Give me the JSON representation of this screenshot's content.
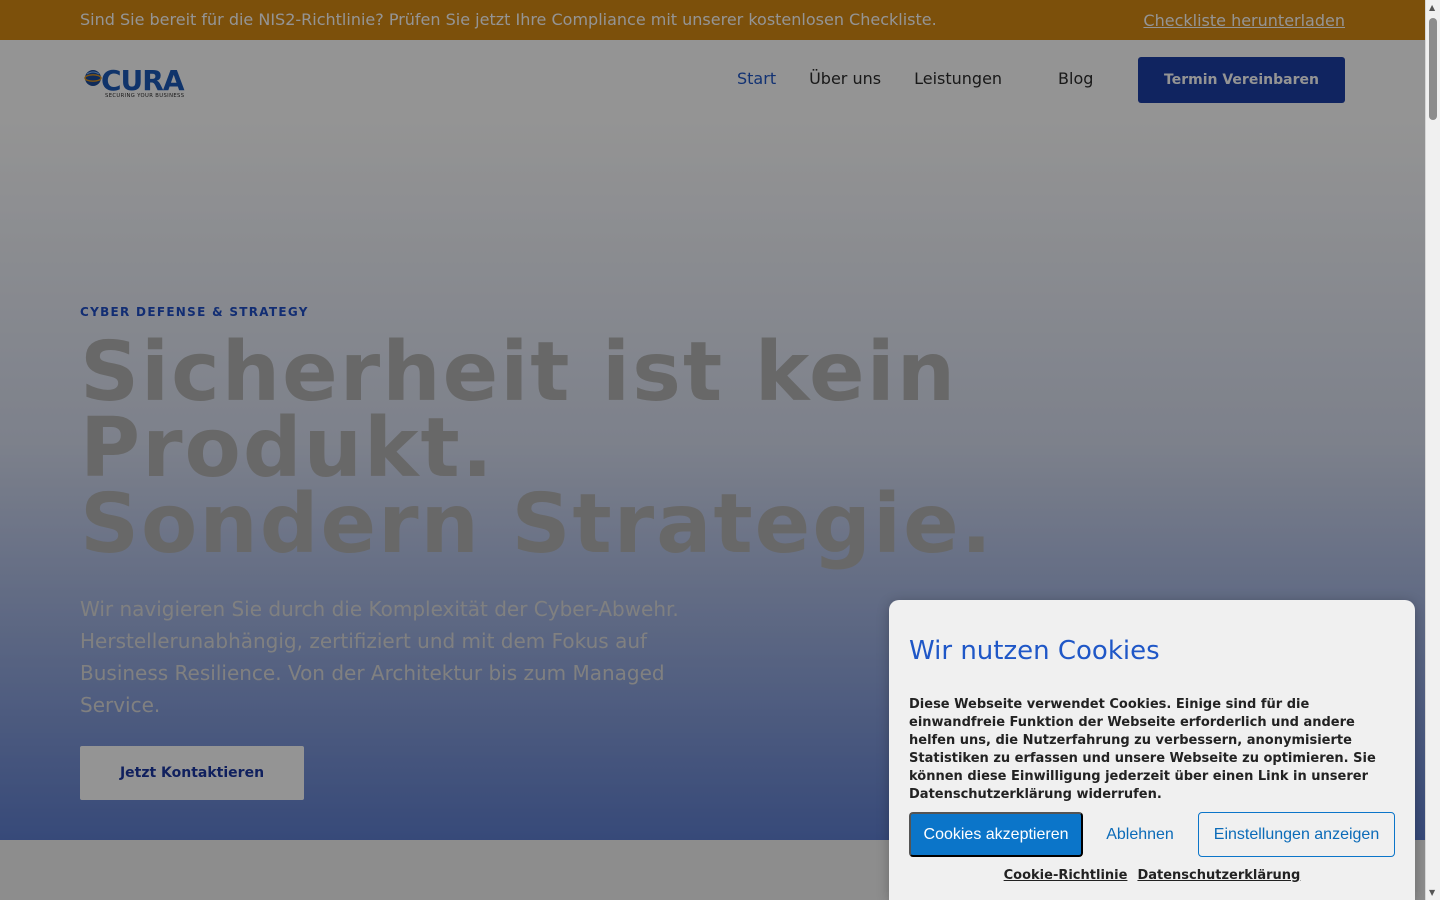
{
  "topbar": {
    "text": "Sind Sie bereit für die NIS2-Richtlinie? Prüfen Sie jetzt Ihre Compliance mit unserer kostenlosen Checkliste.",
    "link": "Checkliste herunterladen"
  },
  "header": {
    "logo": {
      "name": "CURA",
      "tagline": "SECURING YOUR BUSINESS"
    },
    "nav": [
      {
        "label": "Start",
        "active": true
      },
      {
        "label": "Über uns",
        "active": false
      },
      {
        "label": "Leistungen",
        "active": false
      },
      {
        "label": "Blog",
        "active": false
      }
    ],
    "cta": "Termin Vereinbaren"
  },
  "hero": {
    "eyebrow": "CYBER DEFENSE & STRATEGY",
    "headline": [
      "Sicherheit ist kein",
      "Produkt.",
      "Sondern Strategie."
    ],
    "description": "Wir navigieren Sie durch die Komplexität der Cyber-Abwehr. Herstellerunabhängig, zertifiziert und mit dem Fokus auf Business Resilience. Von der Architektur bis zum Managed Service.",
    "cta": "Jetzt Kontaktieren"
  },
  "cookie": {
    "title": "Wir nutzen Cookies",
    "text": "Diese Webseite verwendet Cookies. Einige sind für die einwandfreie Funktion der Webseite erforderlich und andere helfen uns, die Nutzerfahrung zu verbessern, anonymisierte Statistiken zu erfassen und unsere Webseite zu optimieren. Sie können diese Einwilligung jederzeit über einen Link in unserer Datenschutzerklärung widerrufen.",
    "accept": "Cookies akzeptieren",
    "deny": "Ablehnen",
    "settings": "Einstellungen anzeigen",
    "links": [
      "Cookie-Richtlinie",
      "Datenschutzerklärung"
    ]
  },
  "colors": {
    "topbar": "#d68a14",
    "brand_blue": "#1d3ea6",
    "accent_link": "#1f57c7",
    "cookie_button": "#0b75c9"
  }
}
